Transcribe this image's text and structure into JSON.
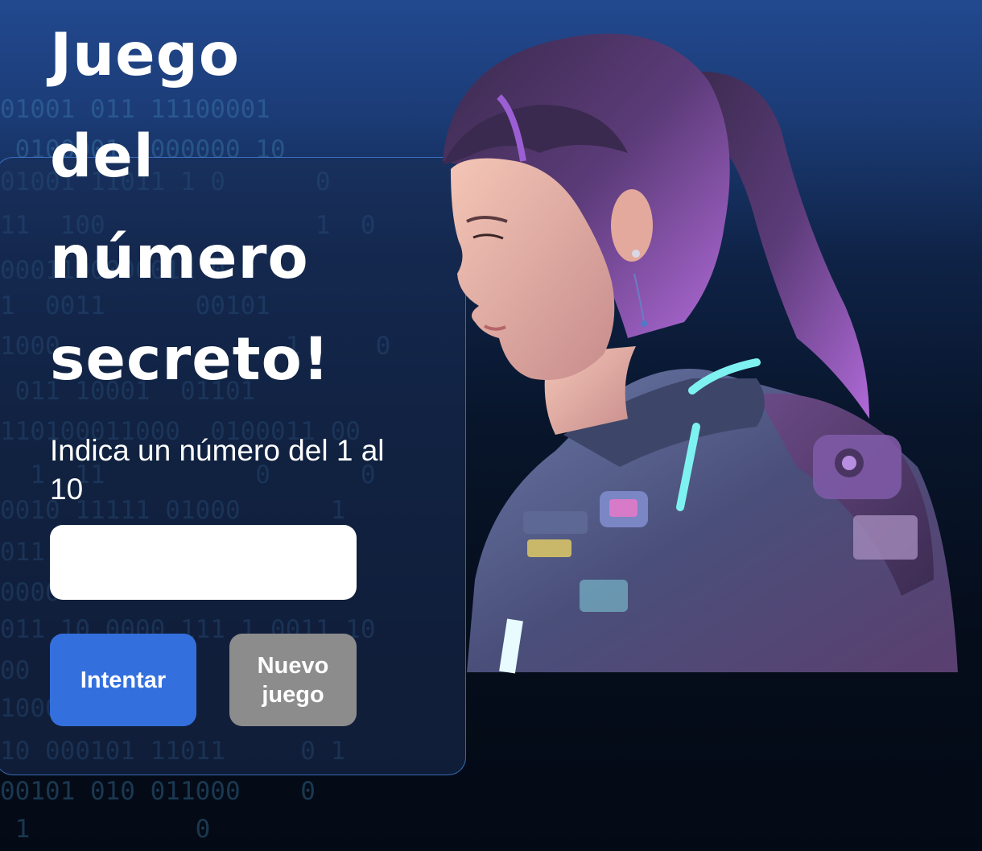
{
  "title": [
    "Juego",
    "del",
    "número",
    "secreto!"
  ],
  "prompt": "Indica un número del 1 al 10",
  "input": {
    "value": "",
    "placeholder": ""
  },
  "buttons": {
    "try_label": "Intentar",
    "new_game_label": "Nuevo juego"
  },
  "background_binary": [
    "01001 011 11100001",
    " 0100001 1000000 10",
    "01001 11011 1 0      0",
    "11  100              1  0",
    "0001100000011 0 0",
    "1  0011      00101",
    "1000               1     0",
    " 011 10001  01101",
    "110100011000  0100011 00",
    "  1  11          0      0",
    "0010 11111 01000      1",
    "011                 1",
    "0000",
    "011 10 0000 111 1 0011 10",
    "00               0",
    "1000                0",
    "10 000101 11011     0 1",
    "00101 010 011000    0",
    " 1           0"
  ],
  "colors": {
    "background_top": "#22498f",
    "background_bottom": "#040a15",
    "panel_border": "#4682dc",
    "try_button": "#3470dd",
    "new_game_button": "#8c8c8c"
  },
  "illustration": {
    "subject": "astronaut-woman-illustration"
  }
}
